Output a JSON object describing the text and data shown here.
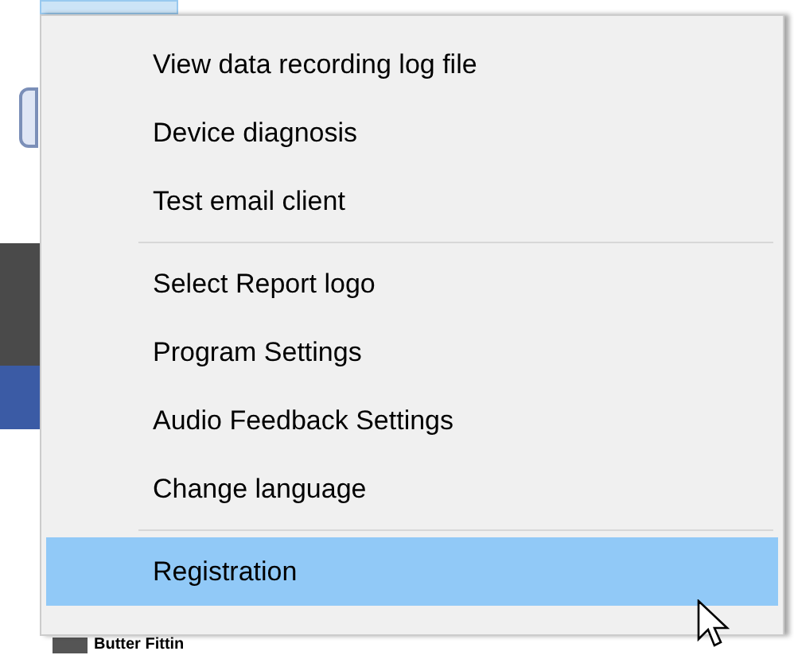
{
  "menu": {
    "groups": [
      {
        "items": [
          {
            "label": "View data recording log file",
            "selected": false
          },
          {
            "label": "Device diagnosis",
            "selected": false
          },
          {
            "label": "Test email client",
            "selected": false
          }
        ]
      },
      {
        "items": [
          {
            "label": "Select Report logo",
            "selected": false
          },
          {
            "label": "Program Settings",
            "selected": false
          },
          {
            "label": "Audio Feedback Settings",
            "selected": false
          },
          {
            "label": "Change language",
            "selected": false
          }
        ]
      },
      {
        "items": [
          {
            "label": "Registration",
            "selected": true
          }
        ]
      }
    ]
  },
  "background_label": "Butter Fittin"
}
